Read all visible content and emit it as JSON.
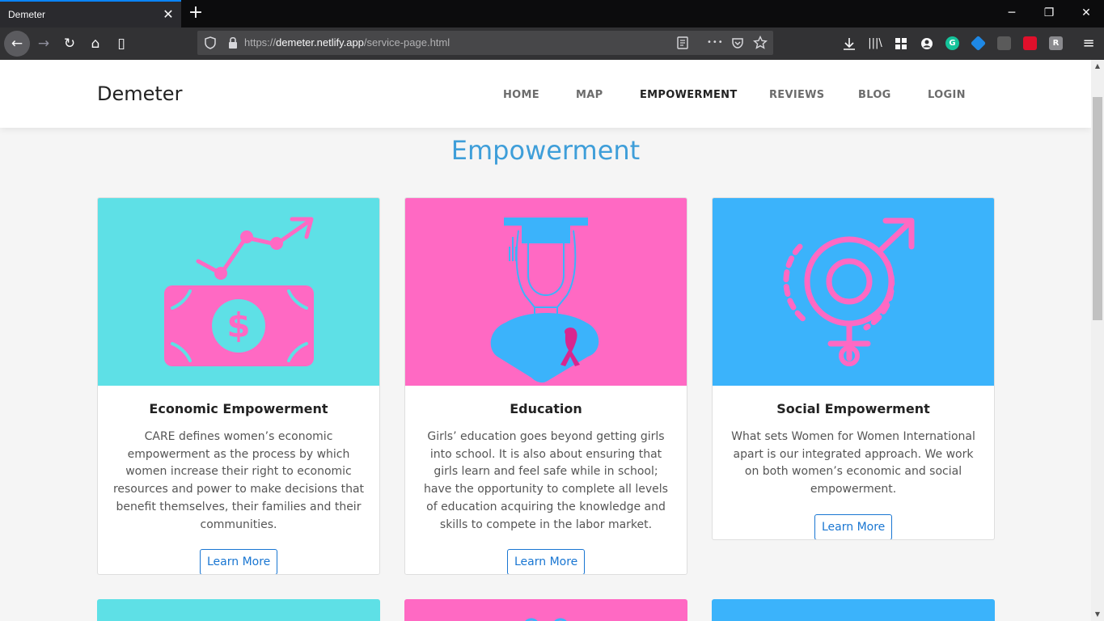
{
  "browser": {
    "tab_title": "Demeter",
    "tab_close": "✕",
    "new_tab": "+",
    "url_scheme": "https://",
    "url_host": "demeter.netlify.app",
    "url_path": "/service-page.html",
    "window_controls": {
      "minimize": "─",
      "restore": "❐",
      "close": "✕"
    },
    "nav": {
      "back": "←",
      "forward": "→",
      "reload": "↻",
      "home": "⌂",
      "sidebar": "▯"
    },
    "toolbar": {
      "more": "•••",
      "library": "|||\\",
      "menu": "≡"
    },
    "extensions": [
      "G",
      "",
      "",
      "",
      "R"
    ]
  },
  "site": {
    "brand": "Demeter",
    "nav": [
      {
        "label": "HOME",
        "active": false
      },
      {
        "label": "MAP",
        "active": false
      },
      {
        "label": "EMPOWERMENT",
        "active": true
      },
      {
        "label": "REVIEWS",
        "active": false
      },
      {
        "label": "BLOG",
        "active": false
      },
      {
        "label": "LOGIN",
        "active": false
      }
    ]
  },
  "page": {
    "title": "Empowerment",
    "cards": [
      {
        "title": "Economic Empowerment",
        "text": "CARE defines women’s economic empowerment as the process by which women increase their right to economic resources and power to make decisions that benefit themselves, their families and their communities.",
        "button": "Learn More",
        "bg_color": "#5ee0e6",
        "icon": "money-growth-icon"
      },
      {
        "title": "Education",
        "text": "Girls’ education goes beyond getting girls into school. It is also about ensuring that girls learn and feel safe while in school; have the opportunity to complete all levels of education acquiring the knowledge and skills to compete in the labor market.",
        "button": "Learn More",
        "bg_color": "#ff69c3",
        "icon": "graduate-woman-icon"
      },
      {
        "title": "Social Empowerment",
        "text": "What sets Women for Women International apart is our integrated approach. We work on both women’s economic and social empowerment.",
        "button": "Learn More",
        "bg_color": "#3bb3fb",
        "icon": "gender-symbol-icon"
      }
    ],
    "next_row_colors": [
      "#5ee0e6",
      "#ff69c3",
      "#3bb3fb"
    ]
  }
}
